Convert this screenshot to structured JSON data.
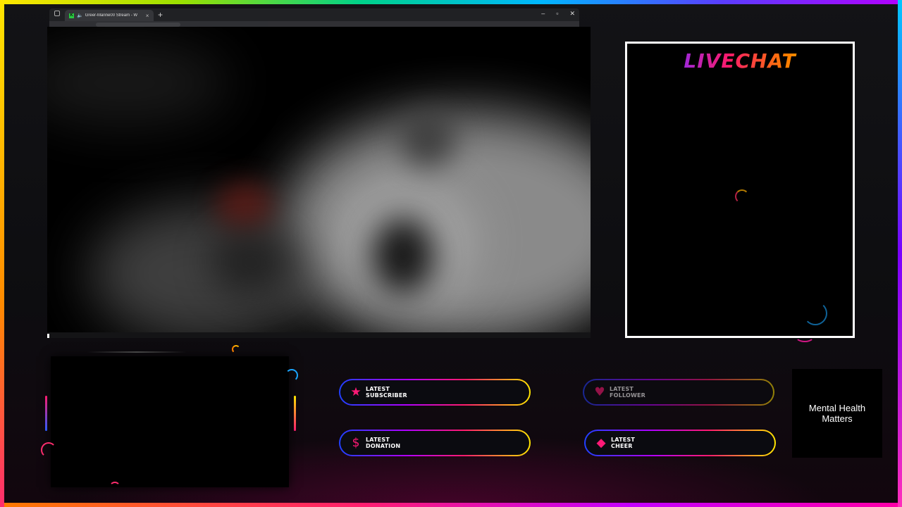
{
  "browser": {
    "tab_title": "Greer-Marine00 Stream - W",
    "new_tab_symbol": "+",
    "tab_close_symbol": "×",
    "window_controls": [
      "–",
      "▫",
      "✕"
    ]
  },
  "livechat": {
    "title": "LIVECHAT"
  },
  "alerts": {
    "subscriber": {
      "line1": "LATEST",
      "line2": "SUBSCRIBER",
      "icon": "star-icon",
      "glyph": "★"
    },
    "follower": {
      "line1": "LATEST",
      "line2": "FOLLOWER",
      "icon": "heart-icon",
      "glyph": "♥"
    },
    "donation": {
      "line1": "LATEST",
      "line2": "DONATION",
      "icon": "dollar-icon",
      "glyph": "$"
    },
    "cheer": {
      "line1": "LATEST",
      "line2": "CHEER",
      "icon": "diamond-icon",
      "glyph": "◆"
    }
  },
  "mental_health": {
    "text": "Mental Health Matters"
  },
  "colors": {
    "accent_pink": "#ff1a76",
    "accent_yellow": "#ffe600",
    "accent_blue": "#2040ff"
  }
}
